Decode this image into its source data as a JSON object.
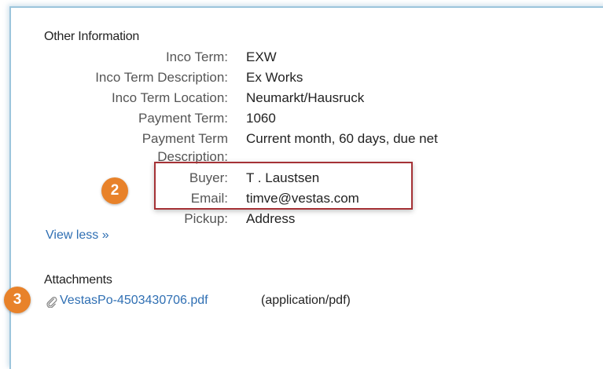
{
  "other_info": {
    "title": "Other Information",
    "rows": [
      {
        "label": "Inco Term:",
        "value": "EXW"
      },
      {
        "label": "Inco Term Description:",
        "value": "Ex Works"
      },
      {
        "label": "Inco Term Location:",
        "value": "Neumarkt/Hausruck"
      },
      {
        "label": "Payment Term:",
        "value": "1060"
      },
      {
        "label": "Payment Term",
        "value": "Current month, 60 days, due net"
      },
      {
        "label": "Description:",
        "value": ""
      },
      {
        "label": "Buyer:",
        "value": "T . Laustsen"
      },
      {
        "label": "Email:",
        "value": "timve@vestas.com"
      },
      {
        "label": "Pickup:",
        "value": "Address"
      }
    ],
    "view_less": "View less »"
  },
  "attachments": {
    "title": "Attachments",
    "file_name": "VestasPo-4503430706.pdf",
    "mime": "(application/pdf)",
    "icon": "paperclip-icon"
  },
  "badges": {
    "two": "2",
    "three": "3",
    "color": "#e8822a"
  },
  "highlight_color": "#a53236"
}
